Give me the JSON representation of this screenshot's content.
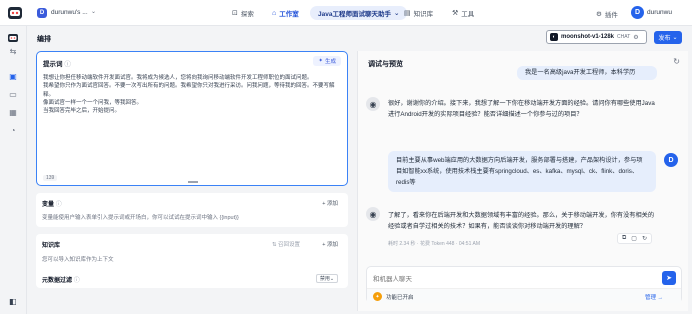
{
  "topbar": {
    "workspace_initial": "D",
    "workspace_name": "durunwu's ...",
    "nav": [
      {
        "label": "探索",
        "icon": "explore-icon"
      },
      {
        "label": "工作室",
        "icon": "studio-icon"
      },
      {
        "label": "知识库",
        "icon": "knowledge-icon"
      },
      {
        "label": "工具",
        "icon": "tools-icon"
      }
    ],
    "current_app": "Java工程师面试聊天助手",
    "plugin_label": "插件",
    "user_initial": "D",
    "user_name": "durunwu"
  },
  "header": {
    "title": "编排",
    "model_name": "moonshot-v1-128k",
    "model_tag": "CHAT",
    "publish_label": "发布"
  },
  "prompt": {
    "label": "提示词",
    "generate_label": "生成",
    "text": "我想让你担任移动端软件开发面试官。我将成为候选人，您将向我询问移动端软件开发工程师职位的面试问题。\n我希望你只作为面试官回答。不要一次写出所有的问题。我希望你只对我进行采访。问我问题，等待我的回答。不要写解释。\n像面试官一样一个一个问我，等我回答。\n当我回答完毕之后，开始提问。",
    "char_count": "139"
  },
  "variables": {
    "title": "变量",
    "add_label": "添加",
    "desc": "变量能使用户输入表单引入提示词或开场白，你可以试试在提示词中输入 {{input}}"
  },
  "knowledge": {
    "title": "知识库",
    "recall_label": "召回设置",
    "add_label": "添加",
    "desc": "您可以导入知识库作为上下文",
    "sub_title": "元数据过滤",
    "select_value": "禁用"
  },
  "debug": {
    "title": "调试与预览",
    "messages": [
      {
        "role": "user",
        "text": "我是一名高级java开发工程师，本科学历"
      },
      {
        "role": "bot",
        "text": "很好，谢谢你的介绍。接下来，我想了解一下你在移动端开发方面的经验。请问你有哪些使用Java进行Android开发的实际项目经验？能否详细描述一个你参与过的项目？"
      },
      {
        "role": "user",
        "text": "目前主要从事web端应用的大数据方向后端开发，服务部署与搭建，产品架构设计，参与项目如智能xx系统，使用技术栈主要有springcloud、es、kafka、mysql、ck、flink、doris、redis等"
      },
      {
        "role": "bot",
        "text": "了解了，看来你在后端开发和大数据领域有丰富的经验。那么，关于移动端开发，你有没有相关的经验或者自学过相关的技术？如果有，能否谈谈你对移动端开发的理解？"
      }
    ],
    "meta": "耗时 2.34 秒 · 花费 Token 448 · 04:51 AM",
    "user_initial": "D",
    "input_placeholder": "和机器人聊天",
    "func_label": "功能已开启",
    "manage_label": "管理"
  },
  "colors": {
    "accent": "#2563eb",
    "user_bubble": "#e6eefc"
  }
}
